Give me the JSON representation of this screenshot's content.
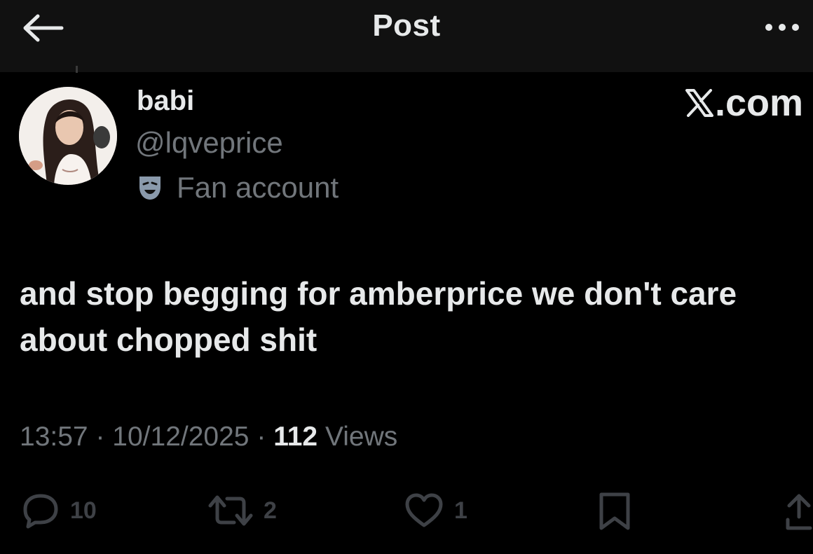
{
  "header": {
    "title": "Post",
    "back_icon": "arrow-left-icon",
    "more_icon": "more-horizontal-icon"
  },
  "post": {
    "author": {
      "name": "babi",
      "handle": "@lqveprice",
      "label": "Fan account",
      "label_icon": "theater-mask-icon"
    },
    "brand": ".com",
    "text": "and stop begging for amberprice we don't care about chopped shit",
    "time": "13:57",
    "date": "10/12/2025",
    "separator": "·",
    "views_count": "112",
    "views_label": "Views"
  },
  "actions": {
    "replies": "10",
    "reposts": "2",
    "likes": "1"
  },
  "colors": {
    "background": "#000000",
    "header_background": "#111111",
    "primary_text": "#e7e9ea",
    "secondary_text": "#71767b",
    "action_icon": "#3e4146"
  }
}
